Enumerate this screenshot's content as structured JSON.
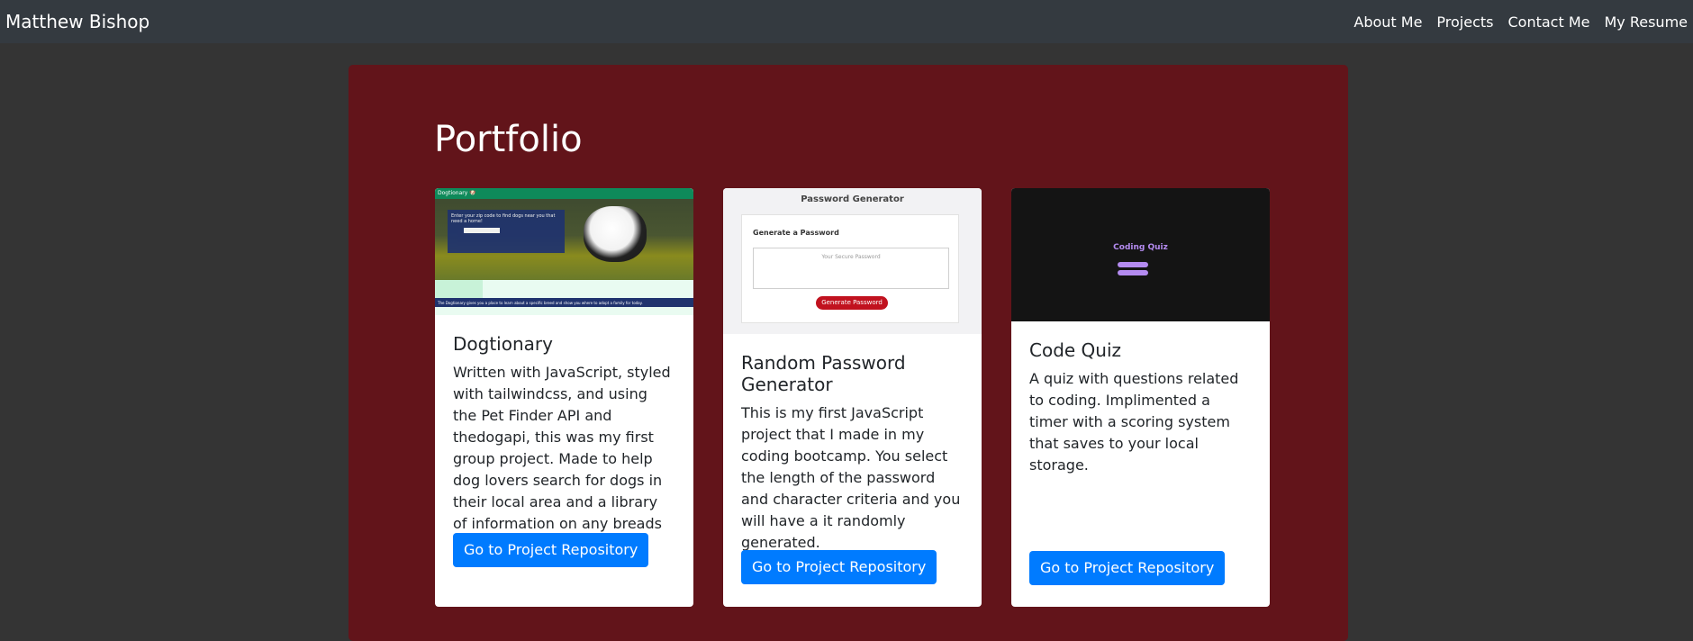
{
  "navbar": {
    "brand": "Matthew Bishop",
    "links": [
      "About Me",
      "Projects",
      "Contact Me",
      "My Resume"
    ]
  },
  "section": {
    "title": "Portfolio"
  },
  "cards": [
    {
      "title": "Dogtionary",
      "text": "Written with JavaScript, styled with tailwindcss, and using the Pet Finder API and thedogapi, this was my first group project. Made to help dog lovers search for dogs in their local area and a library of information on any breads they may be interested in.",
      "button": "Go to Project Repository",
      "shot": {
        "header": "Dogtionary 🐶",
        "panel_text": "Enter your zip code to find dogs near you that need a home!",
        "footer": "The Dogtionary gives you a place to learn about a specific breed and show you where to adopt a family for today."
      }
    },
    {
      "title": "Random Password Generator",
      "text": "This is my first JavaScript project that I made in my coding bootcamp. You select the length of the password and character criteria and you will have a it randomly generated.",
      "button": "Go to Project Repository",
      "shot": {
        "header": "Password Generator",
        "label": "Generate a Password",
        "placeholder": "Your Secure Password",
        "button": "Generate Password"
      }
    },
    {
      "title": "Code Quiz",
      "text": "A quiz with questions related to coding. Implimented a timer with a scoring system that saves to your local storage.",
      "button": "Go to Project Repository",
      "shot": {
        "title": "Coding Quiz"
      }
    }
  ],
  "colors": {
    "navbar_bg": "#343a40",
    "page_bg": "#343434",
    "section_bg": "#62141a",
    "button_bg": "#007bff"
  }
}
